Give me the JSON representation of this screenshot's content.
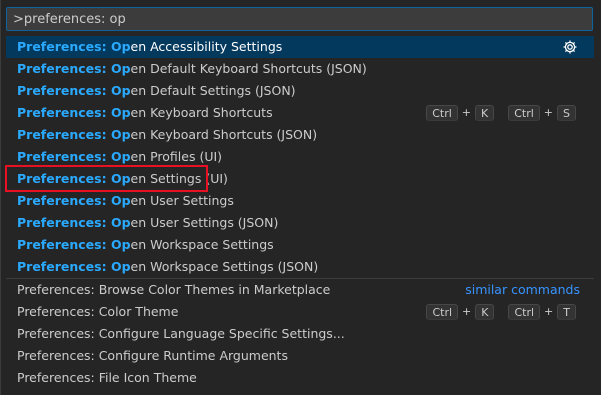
{
  "search": {
    "value": ">preferences: op"
  },
  "results": [
    {
      "hl": "Preferences: Op",
      "rest": "en Accessibility Settings",
      "selected": true,
      "gear": "gear-icon"
    },
    {
      "hl": "Preferences: Op",
      "rest": "en Default Keyboard Shortcuts (JSON)"
    },
    {
      "hl": "Preferences: Op",
      "rest": "en Default Settings (JSON)"
    },
    {
      "hl": "Preferences: Op",
      "rest": "en Keyboard Shortcuts",
      "keys": [
        "Ctrl",
        "K",
        "Ctrl",
        "S"
      ]
    },
    {
      "hl": "Preferences: Op",
      "rest": "en Keyboard Shortcuts (JSON)"
    },
    {
      "hl": "Preferences: Op",
      "rest": "en Profiles (UI)"
    },
    {
      "hl": "Preferences: Op",
      "rest": "en Settings (UI)"
    },
    {
      "hl": "Preferences: Op",
      "rest": "en User Settings"
    },
    {
      "hl": "Preferences: Op",
      "rest": "en User Settings (JSON)"
    },
    {
      "hl": "Preferences: Op",
      "rest": "en Workspace Settings"
    },
    {
      "hl": "Preferences: Op",
      "rest": "en Workspace Settings (JSON)"
    }
  ],
  "similar_label": "similar commands",
  "other_commands": [
    {
      "label": "Preferences: Browse Color Themes in Marketplace"
    },
    {
      "label": "Preferences: Color Theme",
      "keys": [
        "Ctrl",
        "K",
        "Ctrl",
        "T"
      ]
    },
    {
      "label": "Preferences: Configure Language Specific Settings..."
    },
    {
      "label": "Preferences: Configure Runtime Arguments"
    },
    {
      "label": "Preferences: File Icon Theme"
    }
  ],
  "plus_sign": "+",
  "colors": {
    "background": "#252526",
    "selected": "#04395e",
    "match_highlight": "#2aaaff",
    "link": "#3794ff",
    "annotation_box": "#e81123"
  }
}
